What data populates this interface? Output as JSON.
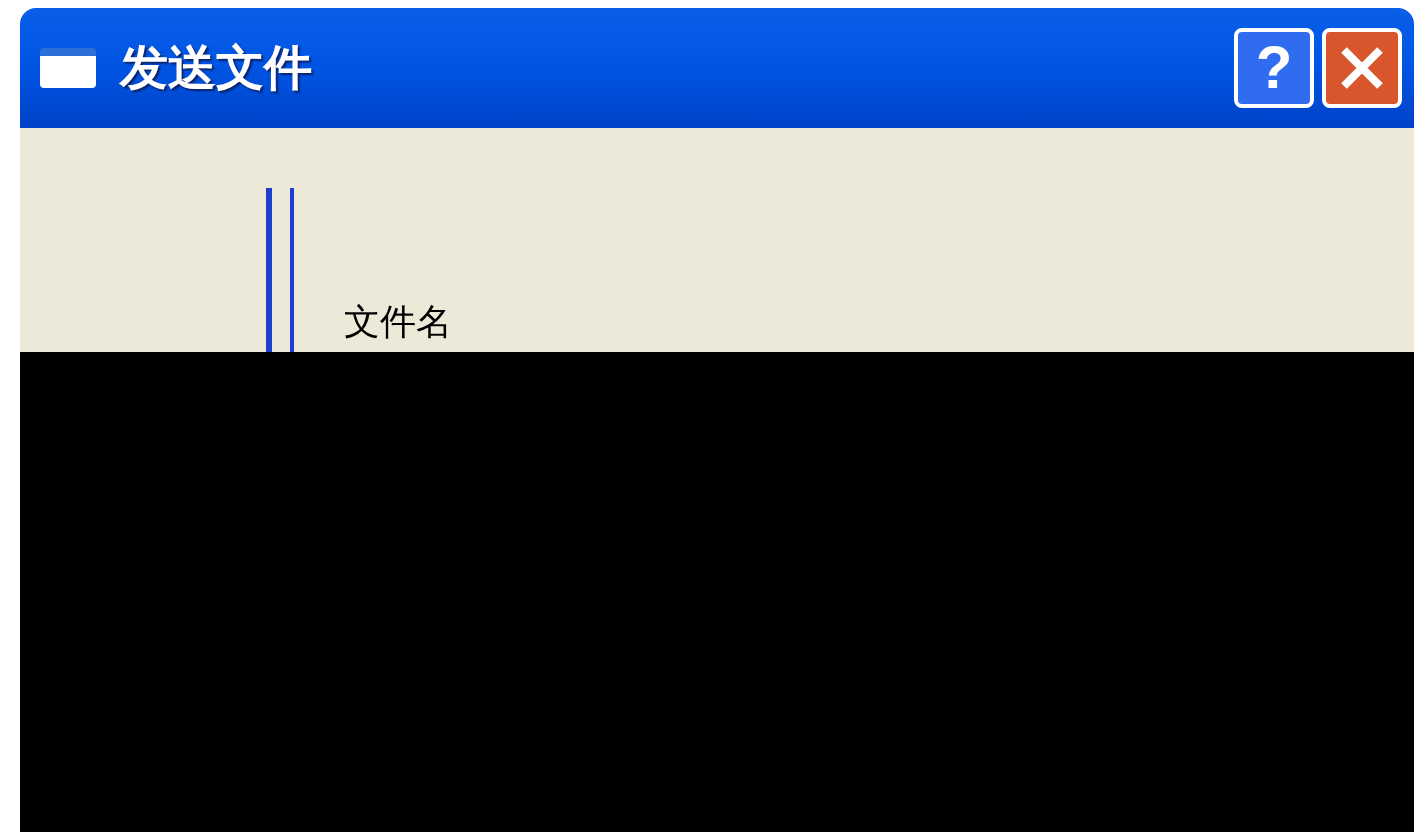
{
  "window": {
    "title": "发送文件",
    "buttons": [
      {
        "kind": "help",
        "label": "?"
      },
      {
        "kind": "close"
      }
    ]
  },
  "form": {
    "file_name_label": "文件名"
  }
}
